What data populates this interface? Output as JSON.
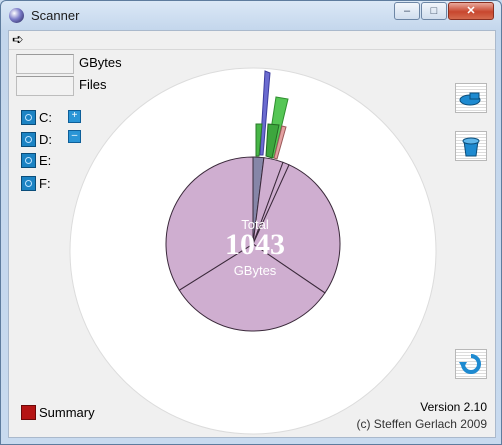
{
  "window": {
    "title": "Scanner",
    "minimize": "–",
    "maximize": "□",
    "close": "✕"
  },
  "menu": {
    "arrow": "➪"
  },
  "readouts": {
    "gbytes_label": "GBytes",
    "gbytes_value": "",
    "files_label": "Files",
    "files_value": ""
  },
  "drives": [
    {
      "label": "C:",
      "expand": "+"
    },
    {
      "label": "D:",
      "expand": "–"
    },
    {
      "label": "E:"
    },
    {
      "label": "F:"
    }
  ],
  "icons": {
    "scan": "disk-scan-icon",
    "trash": "trash-icon",
    "refresh": "refresh-icon"
  },
  "pie": {
    "center_label": "Total",
    "center_value": "1043",
    "center_unit": "GBytes",
    "fill": "#cfaed0",
    "slices": [
      0.02,
      0.036,
      0.012,
      0.277,
      0.316,
      0.339
    ],
    "highlight_color": "#8686a8"
  },
  "footer": {
    "summary_label": "Summary",
    "version": "Version 2.10",
    "copyright": "(c) Steffen Gerlach 2009"
  }
}
